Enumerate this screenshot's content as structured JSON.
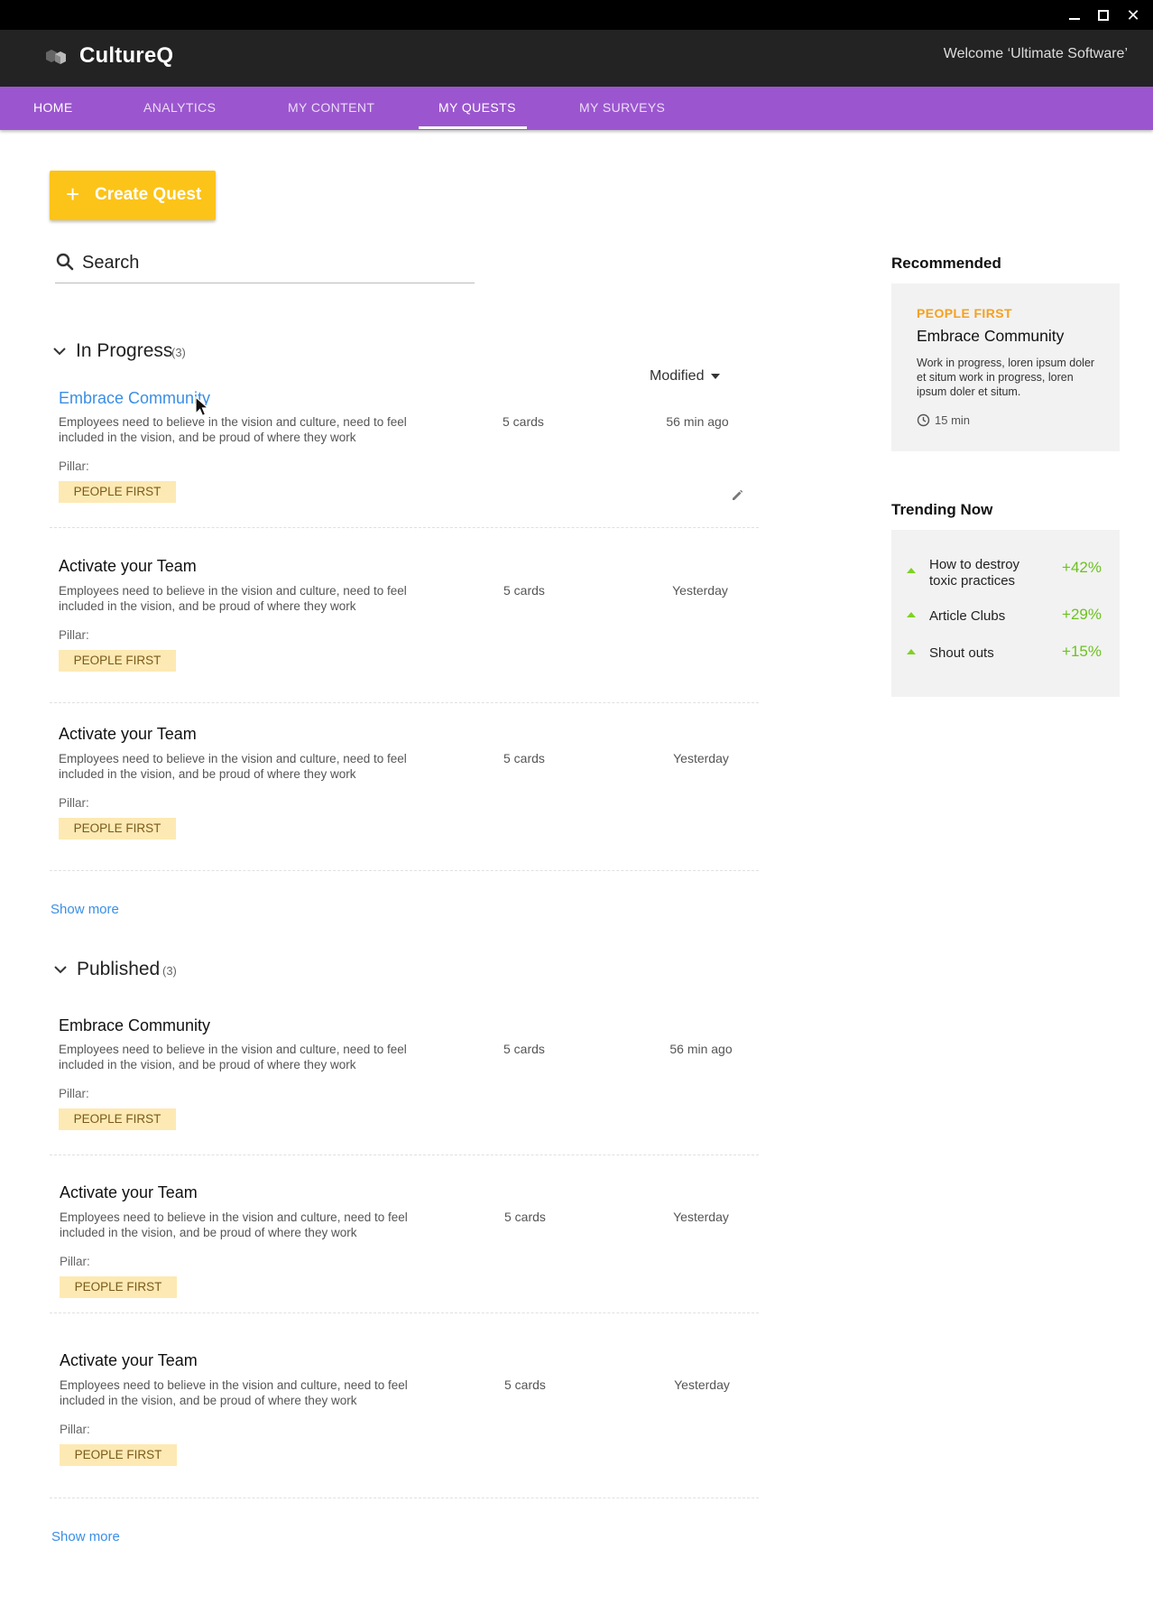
{
  "window": {
    "minimize": "–",
    "maximize": "☐",
    "close": "✕"
  },
  "app": {
    "brand": "CultureQ",
    "welcome": "Welcome ‘Ultimate Software’"
  },
  "nav": {
    "items": [
      {
        "label": "HOME"
      },
      {
        "label": "ANALYTICS"
      },
      {
        "label": "MY CONTENT"
      },
      {
        "label": "MY QUESTS",
        "active": true
      },
      {
        "label": "MY SURVEYS"
      }
    ]
  },
  "actions": {
    "create_plus": "+",
    "create_label": "Create Quest"
  },
  "search": {
    "placeholder": "Search"
  },
  "sort": {
    "label": "Modified"
  },
  "in_progress": {
    "title": "In Progress",
    "count": "(3)",
    "show_more": "Show more",
    "quests": [
      {
        "title": "Embrace Community",
        "desc": "Employees need to believe in the vision and culture, need to feel included in the vision, and be proud of where they work",
        "cards": "5 cards",
        "when": "56 min ago",
        "pillar_label": "Pillar:",
        "pillar": "PEOPLE FIRST"
      },
      {
        "title": "Activate your Team",
        "desc": "Employees need to believe in the vision and culture, need to feel included in the vision, and be proud of where they work",
        "cards": "5 cards",
        "when": "Yesterday",
        "pillar_label": "Pillar:",
        "pillar": "PEOPLE FIRST"
      },
      {
        "title": "Activate your Team",
        "desc": "Employees need to believe in the vision and culture, need to feel included in the vision, and be proud of where they work",
        "cards": "5 cards",
        "when": "Yesterday",
        "pillar_label": "Pillar:",
        "pillar": "PEOPLE FIRST"
      }
    ]
  },
  "published": {
    "title": "Published",
    "count": "(3)",
    "show_more": "Show more",
    "quests": [
      {
        "title": "Embrace Community",
        "desc": "Employees need to believe in the vision and culture, need to feel included in the vision, and be proud of where they work",
        "cards": "5 cards",
        "when": "56 min ago",
        "pillar_label": "Pillar:",
        "pillar": "PEOPLE FIRST"
      },
      {
        "title": "Activate your Team",
        "desc": "Employees need to believe in the vision and culture, need to feel included in the vision, and be proud of where they work",
        "cards": "5 cards",
        "when": "Yesterday",
        "pillar_label": "Pillar:",
        "pillar": "PEOPLE FIRST"
      },
      {
        "title": "Activate your Team",
        "desc": "Employees need to believe in the vision and culture, need to feel included in the vision, and be proud of where they work",
        "cards": "5 cards",
        "when": "Yesterday",
        "pillar_label": "Pillar:",
        "pillar": "PEOPLE FIRST"
      }
    ]
  },
  "recommended": {
    "heading": "Recommended",
    "kicker": "PEOPLE FIRST",
    "title": "Embrace Community",
    "desc": "Work in progress, loren ipsum doler et situm work in progress, loren ipsum doler et situm.",
    "duration": "15 min"
  },
  "trending": {
    "heading": "Trending Now",
    "items": [
      {
        "label": "How to destroy toxic practices",
        "pct": "+42%"
      },
      {
        "label": "Article Clubs",
        "pct": "+29%"
      },
      {
        "label": "Shout outs",
        "pct": "+15%"
      }
    ]
  },
  "colors": {
    "nav": "#9b56cf",
    "accent_button": "#fcc419",
    "link": "#3a8ee6",
    "tag_bg": "#fde9b3",
    "trend_up": "#6cc21f",
    "kicker": "#f5a020"
  },
  "icons": {
    "search": "search-icon",
    "chevron": "chevron-down-icon",
    "edit": "pencil-icon",
    "clock": "clock-icon",
    "trend": "trend-up-arrow-icon",
    "logo": "hexagon-logo-icon"
  }
}
